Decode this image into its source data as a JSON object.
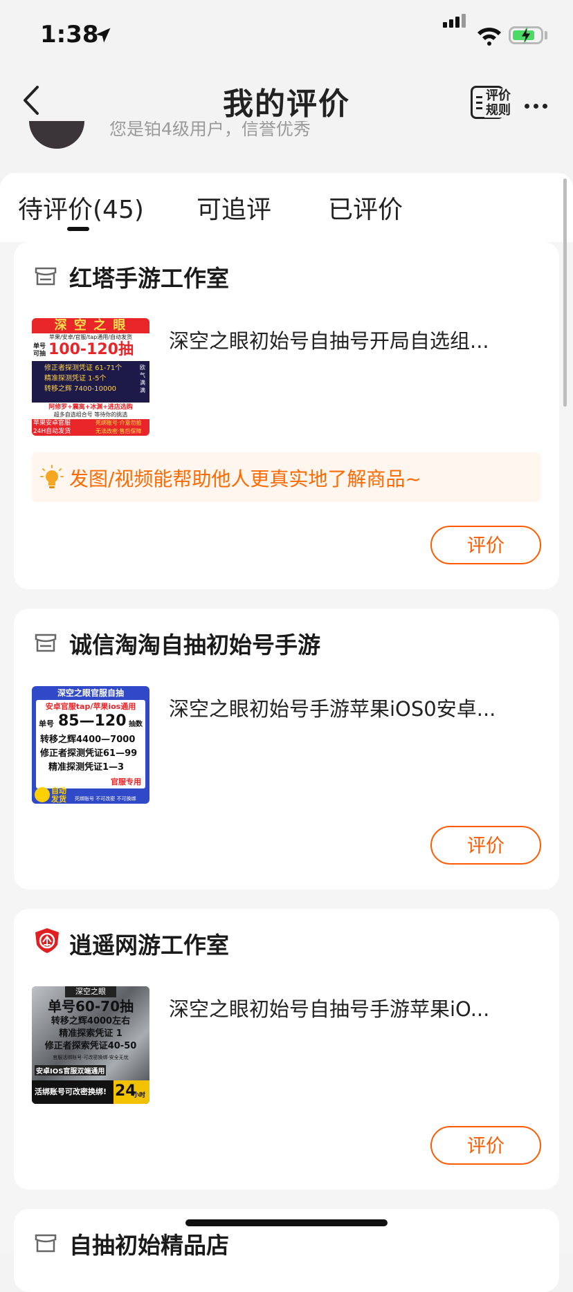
{
  "status": {
    "time": "1:38"
  },
  "nav": {
    "title": "我的评价",
    "rules_line1": "评价",
    "rules_line2": "规则"
  },
  "profile": {
    "partial_text": "您是铂4级用户，信誉优秀"
  },
  "tabs": [
    {
      "label": "待评价(45)",
      "active": true
    },
    {
      "label": "可追评",
      "active": false
    },
    {
      "label": "已评价",
      "active": false
    }
  ],
  "cards": [
    {
      "shop_name": "红塔手游工作室",
      "product_title": "深空之眼初始号自抽号开局自选组...",
      "tip": "发图/视频能帮助他人更真实地了解商品~",
      "button": "评价",
      "thumb": {
        "l1": "深 空 之 眼",
        "l2": "苹果/安卓/官服/tap通用/自动发货",
        "l3a": "单号",
        "l3b": "可抽",
        "l3c": "100-120抽",
        "l4": "修正者探测凭证 61-71个",
        "l5": "精准探测凭证  1-5个",
        "l6": "转移之辉  7400-10000",
        "l7": "阿修罗+震离+冰渊+进店选购",
        "l8": "超多自选组合号 等待你的挑选",
        "l9": "苹果安卓官服",
        "l10": "24H自动发货",
        "l11": "死绑账号·介意勿拍",
        "l12": "无法改密·售后保障",
        "side": "欧气满满"
      }
    },
    {
      "shop_name": "诚信淘淘自抽初始号手游",
      "product_title": "深空之眼初始号手游苹果iOS0安卓...",
      "button": "评价",
      "thumb": {
        "l1": "深空之眼官服自抽",
        "l2": "安卓官服tap/苹果ios通用",
        "l3a": "单号",
        "l3b": "85—120",
        "l3c": "抽数",
        "l4": "转移之辉4400—7000",
        "l5": "修正者探测凭证61—99",
        "l6": "精准探测凭证1—3",
        "l7": "官服专用",
        "l8": "自动",
        "l9": "发货",
        "l10": "死绑账号 不可改密 不可换绑"
      }
    },
    {
      "shop_name": "逍遥网游工作室",
      "product_title": "深空之眼初始号自抽号手游苹果iO...",
      "button": "评价",
      "thumb": {
        "l1": "深空之眼",
        "l2": "单号60-70抽",
        "l3": "转移之辉4000左右",
        "l4": "精准探索凭证 1",
        "l5": "修正者探索凭证40-50",
        "l6": "官服活绑账号·可改密换绑·安全无忧",
        "l7": "安卓IOS官服双端通用",
        "l8": "活绑账号可改密换绑!",
        "l9": "24",
        "l10": "小时"
      }
    },
    {
      "shop_name": "自抽初始精品店"
    }
  ],
  "colors": {
    "accent": "#ff5a00",
    "tip_bg": "#fff6f0",
    "tip_text": "#ff6a00"
  }
}
